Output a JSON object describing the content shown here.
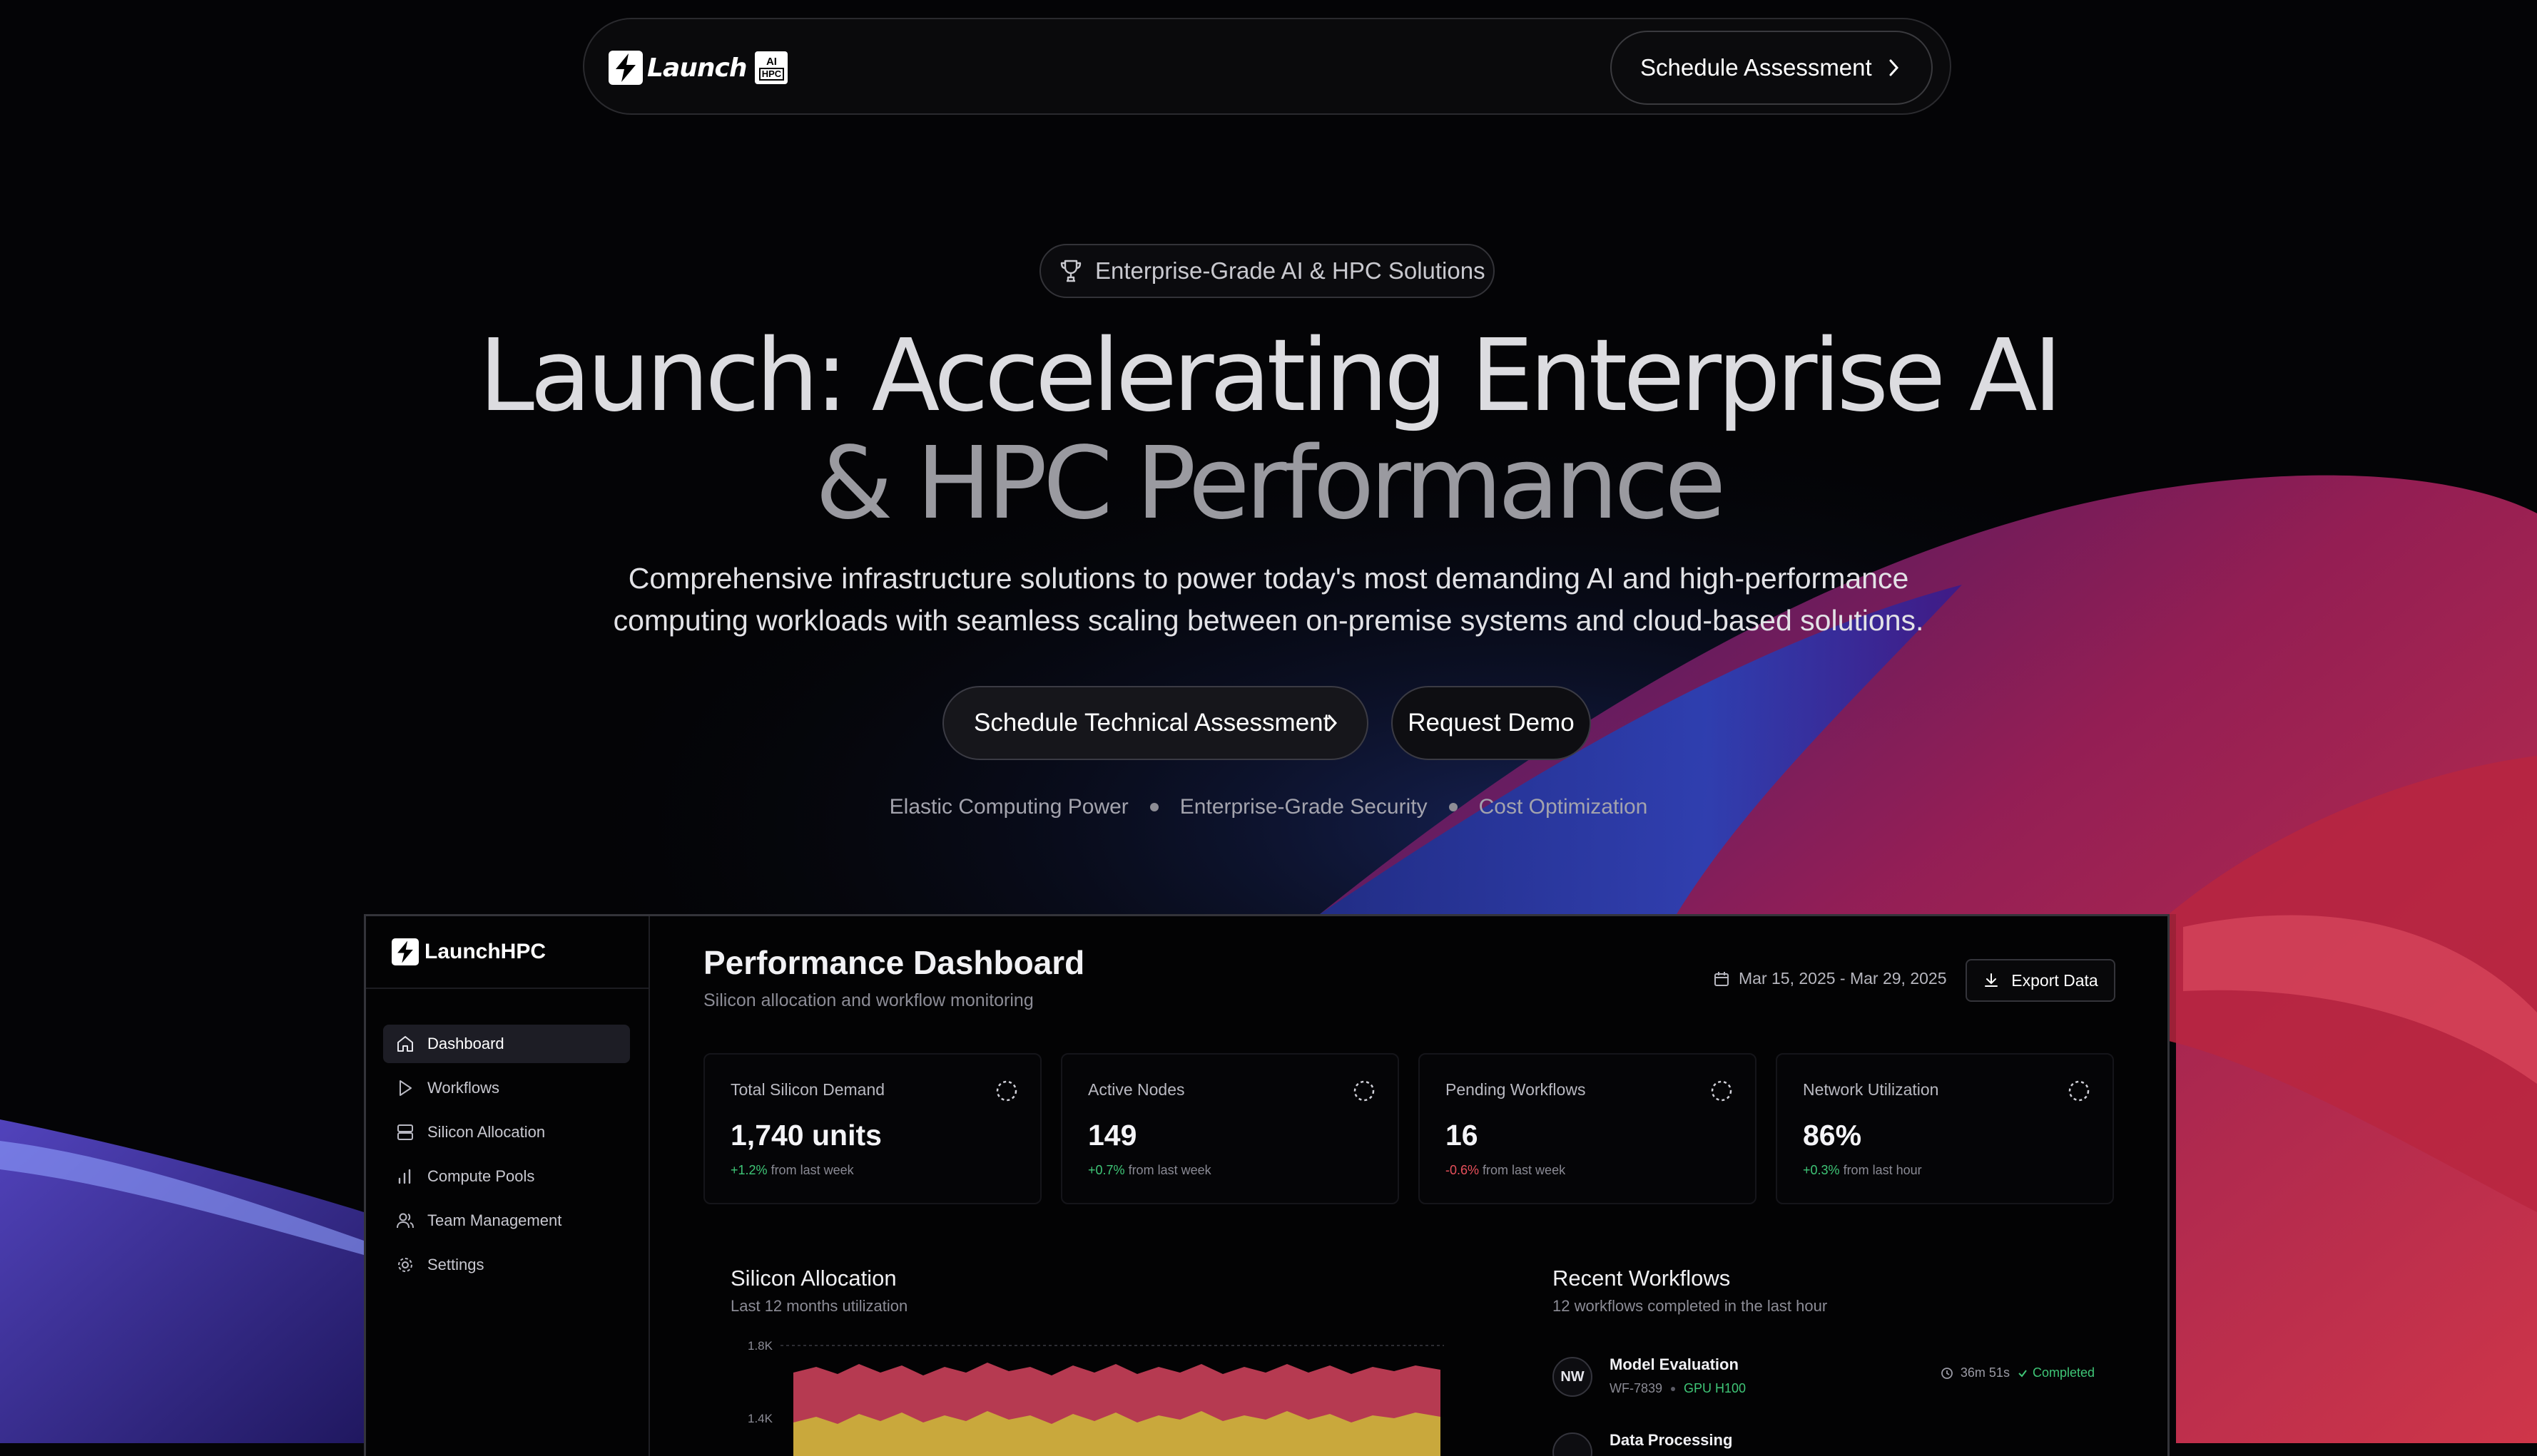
{
  "nav": {
    "logo_text": "Launch",
    "logo_badge_top": "AI",
    "logo_badge_bottom": "HPC",
    "cta_label": "Schedule Assessment"
  },
  "hero": {
    "badge": "Enterprise-Grade AI & HPC Solutions",
    "title_line1": "Launch: Accelerating Enterprise AI",
    "title_line2": "& HPC Performance",
    "subtitle_line1": "Comprehensive infrastructure solutions to power today's most demanding AI and high-performance",
    "subtitle_line2": "computing workloads with seamless scaling between on-premise systems and cloud-based solutions.",
    "primary_button": "Schedule Technical Assessment",
    "secondary_button": "Request Demo",
    "features": [
      "Elastic Computing Power",
      "Enterprise-Grade Security",
      "Cost Optimization"
    ]
  },
  "dashboard": {
    "sidebar": {
      "title": "LaunchHPC",
      "items": [
        {
          "label": "Dashboard",
          "icon": "home-icon",
          "active": true
        },
        {
          "label": "Workflows",
          "icon": "play-icon",
          "active": false
        },
        {
          "label": "Silicon Allocation",
          "icon": "server-icon",
          "active": false
        },
        {
          "label": "Compute Pools",
          "icon": "bar-chart-icon",
          "active": false
        },
        {
          "label": "Team Management",
          "icon": "users-icon",
          "active": false
        },
        {
          "label": "Settings",
          "icon": "gear-icon",
          "active": false
        }
      ]
    },
    "title": "Performance Dashboard",
    "subtitle": "Silicon allocation and workflow monitoring",
    "date_range": "Mar 15, 2025 - Mar 29, 2025",
    "export_label": "Export Data",
    "cards": [
      {
        "label": "Total Silicon Demand",
        "value": "1,740 units",
        "change": "+1.2%",
        "period": "from last week",
        "trend": "up"
      },
      {
        "label": "Active Nodes",
        "value": "149",
        "change": "+0.7%",
        "period": "from last week",
        "trend": "up"
      },
      {
        "label": "Pending Workflows",
        "value": "16",
        "change": "-0.6%",
        "period": "from last week",
        "trend": "down"
      },
      {
        "label": "Network Utilization",
        "value": "86%",
        "change": "+0.3%",
        "period": "from last hour",
        "trend": "up"
      }
    ],
    "allocation": {
      "title": "Silicon Allocation",
      "subtitle": "Last 12 months utilization",
      "y_ticks": [
        "1.8K",
        "1.4K"
      ]
    },
    "workflows": {
      "title": "Recent Workflows",
      "subtitle": "12 workflows completed in the last hour",
      "items": [
        {
          "initials": "NW",
          "name": "Model Evaluation",
          "id": "WF-7839",
          "gpu": "GPU H100",
          "duration": "36m 51s",
          "status": "Completed"
        },
        {
          "initials": "",
          "name": "Data Processing",
          "id": "",
          "gpu": "",
          "duration": "",
          "status": ""
        }
      ]
    }
  },
  "colors": {
    "background": "#040406",
    "positive": "#3fc677",
    "negative": "#e8505b",
    "chart_red": "#d9485f",
    "chart_yellow": "#d8b84a"
  }
}
